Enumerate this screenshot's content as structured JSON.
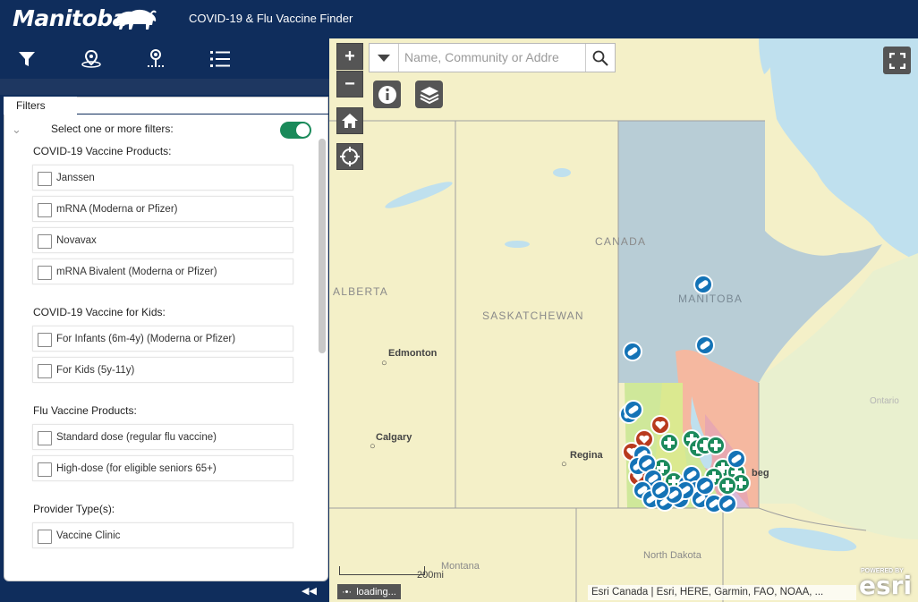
{
  "header": {
    "logo_text": "Manitoba",
    "app_title": "COVID-19 & Flu Vaccine Finder"
  },
  "toolbar": {
    "tools": [
      "filter-icon",
      "locate-pin-icon",
      "directions-icon",
      "list-icon"
    ]
  },
  "panel": {
    "tab_label": "Filters",
    "select_label": "Select one or more filters:",
    "toggle_on": true,
    "sections": [
      {
        "title": "COVID-19 Vaccine Products:",
        "options": [
          "Janssen",
          "mRNA (Moderna or Pfizer)",
          "Novavax",
          "mRNA Bivalent (Moderna or Pfizer)"
        ]
      },
      {
        "title": "COVID-19 Vaccine for Kids:",
        "options": [
          "For Infants (6m-4y) (Moderna or Pfizer)",
          "For Kids (5y-11y)"
        ]
      },
      {
        "title": "Flu Vaccine Products:",
        "options": [
          "Standard dose (regular flu vaccine)",
          "High-dose (for eligible seniors 65+)"
        ]
      },
      {
        "title": "Provider Type(s):",
        "options": [
          "Vaccine Clinic"
        ]
      }
    ]
  },
  "map": {
    "search_placeholder": "Name, Community or Addre",
    "labels": {
      "canada": "CANADA",
      "alberta": "ALBERTA",
      "saskatchewan": "SASKATCHEWAN",
      "manitoba": "MANITOBA",
      "north_dakota": "North Dakota",
      "montana": "Montana",
      "ontario": "Ontario"
    },
    "cities": {
      "edmonton": "Edmonton",
      "calgary": "Calgary",
      "regina": "Regina",
      "winnipeg": "beg"
    },
    "scale_label": "200mi",
    "loading_text": "loading...",
    "attribution": "Esri Canada | Esri, HERE, Garmin, FAO, NOAA, ...",
    "esri_powered": "POWERED BY",
    "esri_logo": "esri",
    "colors": {
      "land": "#f4f0c8",
      "water": "#bfe0ee",
      "manitoba_north": "#b8cdd6",
      "region_orange": "#f5b8a0",
      "region_pink": "#e8a8b0",
      "region_green": "#cfe89a",
      "pin_blue": "#1473b6",
      "pin_green": "#1c8a5c",
      "pin_red": "#b83a1e"
    }
  }
}
